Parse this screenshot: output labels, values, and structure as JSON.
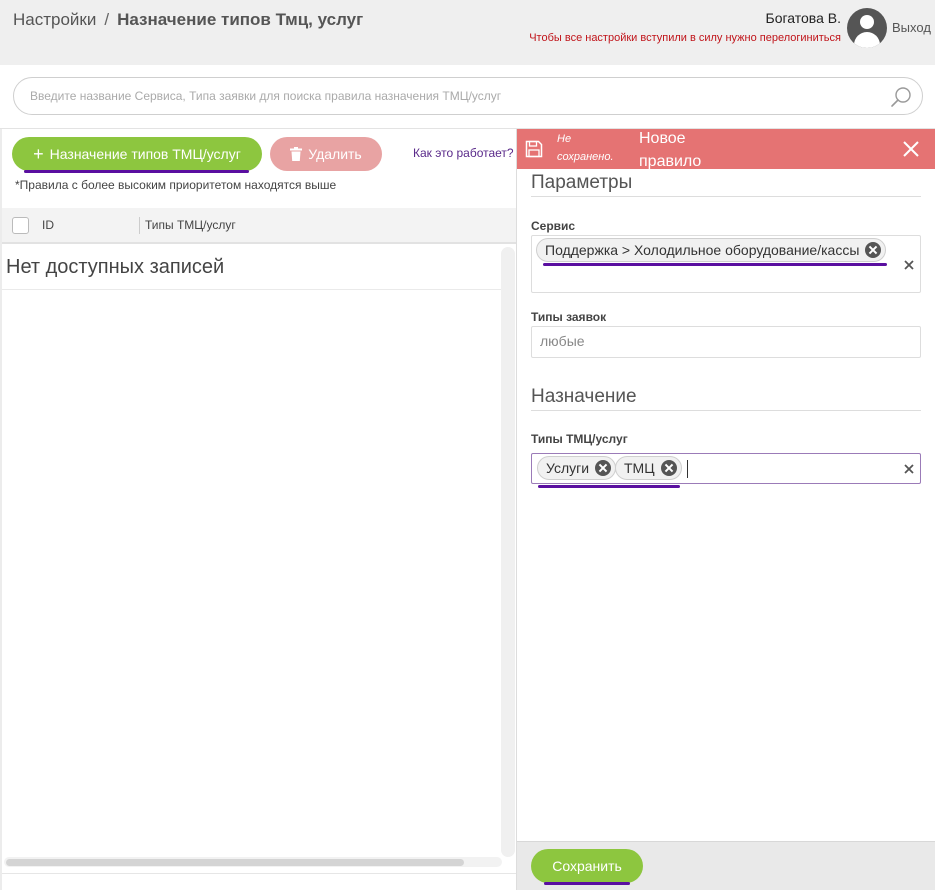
{
  "header": {
    "breadcrumb_root": "Настройки",
    "breadcrumb_sep": "/",
    "page_title": "Назначение типов Тмц, услуг",
    "user_name": "Богатова В.",
    "relogin_notice": "Чтобы все настройки вступили в силу нужно перелогиниться",
    "logout_label": "Выход"
  },
  "search": {
    "placeholder": "Введите название Сервиса, Типа заявки для поиска правила назначения ТМЦ/услуг",
    "value": ""
  },
  "toolbar": {
    "add_label": "Назначение типов ТМЦ/услуг",
    "delete_label": "Удалить",
    "help_link": "Как это работает?",
    "priority_hint": "*Правила с более высоким приоритетом находятся выше"
  },
  "table": {
    "columns": [
      "ID",
      "Типы ТМЦ/услуг"
    ],
    "empty_text": "Нет доступных записей"
  },
  "editor": {
    "status": "Не сохранено.",
    "title": "Новое правило",
    "sections": {
      "params": "Параметры",
      "assignment": "Назначение"
    },
    "service_label": "Сервис",
    "service_chips": [
      "Поддержка > Холодильное оборудование/кассы"
    ],
    "request_types_label": "Типы заявок",
    "request_types_value": "любые",
    "item_types_label": "Типы ТМЦ/услуг",
    "item_type_chips": [
      "Услуги",
      "ТМЦ"
    ],
    "save_label": "Сохранить"
  },
  "colors": {
    "accent_green": "#8dc63f",
    "danger_header": "#e57373",
    "delete_button": "#e8a3a3",
    "underline_purple": "#5a0fa0",
    "notice_red": "#c0141a"
  }
}
